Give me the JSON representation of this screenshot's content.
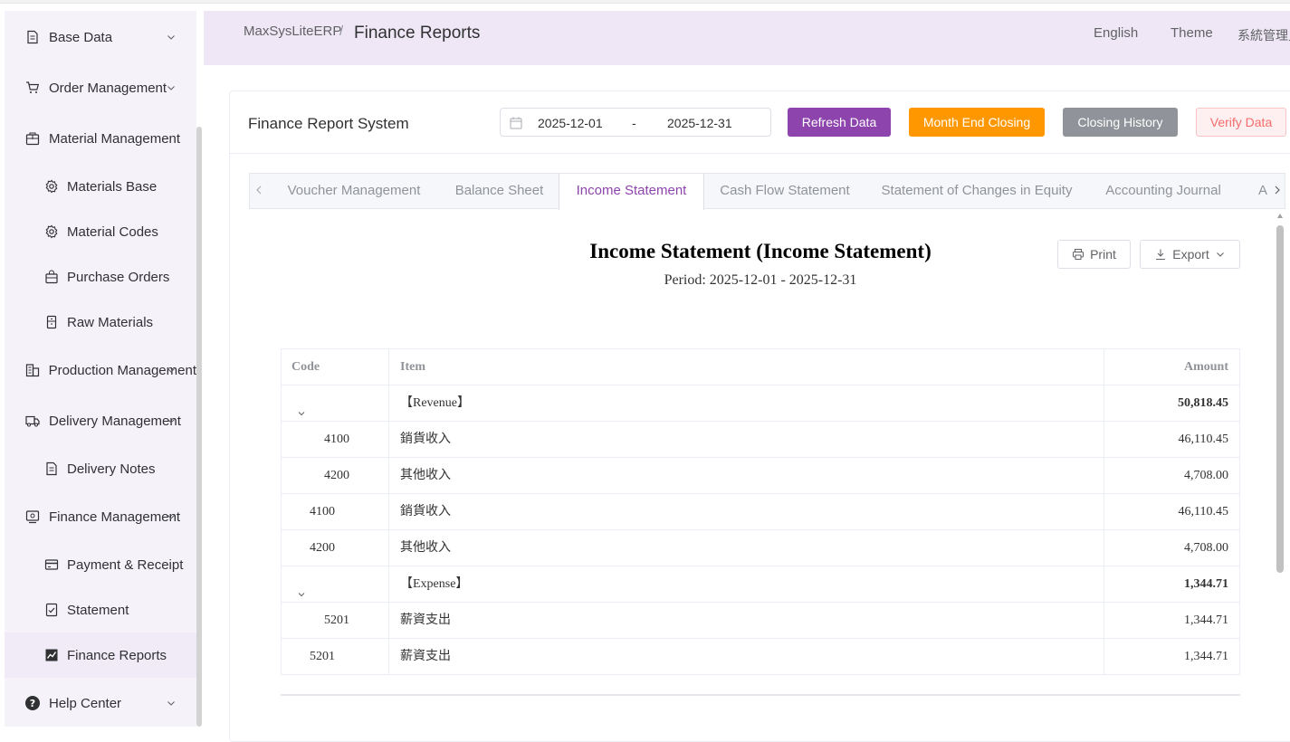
{
  "sidebar": {
    "items": [
      {
        "label": "Base Data",
        "icon": "document-icon",
        "sub": false,
        "chevron": true
      },
      {
        "label": "Order Management",
        "icon": "cart-icon",
        "sub": false,
        "chevron": true
      },
      {
        "label": "Material Management",
        "icon": "box-icon",
        "sub": false,
        "chevron": false
      },
      {
        "label": "Materials Base",
        "icon": "gear-icon",
        "sub": true,
        "chevron": false
      },
      {
        "label": "Material Codes",
        "icon": "gear-icon",
        "sub": true,
        "chevron": false
      },
      {
        "label": "Purchase Orders",
        "icon": "bag-icon",
        "sub": true,
        "chevron": false
      },
      {
        "label": "Raw Materials",
        "icon": "box-sm-icon",
        "sub": true,
        "chevron": false
      },
      {
        "label": "Production Management",
        "icon": "building-icon",
        "sub": false,
        "chevron": true
      },
      {
        "label": "Delivery Management",
        "icon": "truck-icon",
        "sub": false,
        "chevron": true
      },
      {
        "label": "Delivery Notes",
        "icon": "document-icon",
        "sub": true,
        "chevron": false
      },
      {
        "label": "Finance Management",
        "icon": "finance-icon",
        "sub": false,
        "chevron": true
      },
      {
        "label": "Payment & Receipt",
        "icon": "card-icon",
        "sub": true,
        "chevron": false
      },
      {
        "label": "Statement",
        "icon": "checklist-icon",
        "sub": true,
        "chevron": false
      },
      {
        "label": "Finance Reports",
        "icon": "chart-icon",
        "sub": true,
        "chevron": false,
        "active": true
      },
      {
        "label": "Help Center",
        "icon": "question-icon",
        "sub": false,
        "chevron": true
      }
    ]
  },
  "header": {
    "breadcrumb_home": "MaxSysLiteERP",
    "breadcrumb_sep": "/",
    "breadcrumb_current": "Finance Reports",
    "language": "English",
    "theme": "Theme",
    "user": "系統管理員"
  },
  "toolbar": {
    "title": "Finance Report System",
    "date_start": "2025-12-01",
    "date_sep": "-",
    "date_end": "2025-12-31",
    "refresh_label": "Refresh Data",
    "closing_label": "Month End Closing",
    "history_label": "Closing History",
    "verify_label": "Verify Data"
  },
  "tabs": [
    {
      "label": "Voucher Management",
      "active": false
    },
    {
      "label": "Balance Sheet",
      "active": false
    },
    {
      "label": "Income Statement",
      "active": true
    },
    {
      "label": "Cash Flow Statement",
      "active": false
    },
    {
      "label": "Statement of Changes in Equity",
      "active": false
    },
    {
      "label": "Accounting Journal",
      "active": false
    },
    {
      "label": "A",
      "active": false
    }
  ],
  "report": {
    "title": "Income Statement (Income Statement)",
    "period": "Period: 2025-12-01 - 2025-12-31",
    "print_label": "Print",
    "export_label": "Export",
    "columns": {
      "code": "Code",
      "item": "Item",
      "amount": "Amount"
    },
    "rows": [
      {
        "type": "group",
        "code": "",
        "item": "【Revenue】",
        "amount": "50,818.45"
      },
      {
        "type": "child",
        "code": "4100",
        "item": "銷貨收入",
        "amount": "46,110.45"
      },
      {
        "type": "child",
        "code": "4200",
        "item": "其他收入",
        "amount": "4,708.00"
      },
      {
        "type": "flat",
        "code": "4100",
        "item": "銷貨收入",
        "amount": "46,110.45"
      },
      {
        "type": "flat",
        "code": "4200",
        "item": "其他收入",
        "amount": "4,708.00"
      },
      {
        "type": "group",
        "code": "",
        "item": "【Expense】",
        "amount": "1,344.71"
      },
      {
        "type": "child",
        "code": "5201",
        "item": "薪資支出",
        "amount": "1,344.71"
      },
      {
        "type": "flat",
        "code": "5201",
        "item": "薪資支出",
        "amount": "1,344.71"
      }
    ]
  },
  "colors": {
    "accent": "#8e44ad",
    "warning": "#ff9800",
    "info": "#909399",
    "danger": "#f56c6c",
    "sidebar_bg": "#f6f2fa",
    "header_bg": "#efe7f5"
  }
}
